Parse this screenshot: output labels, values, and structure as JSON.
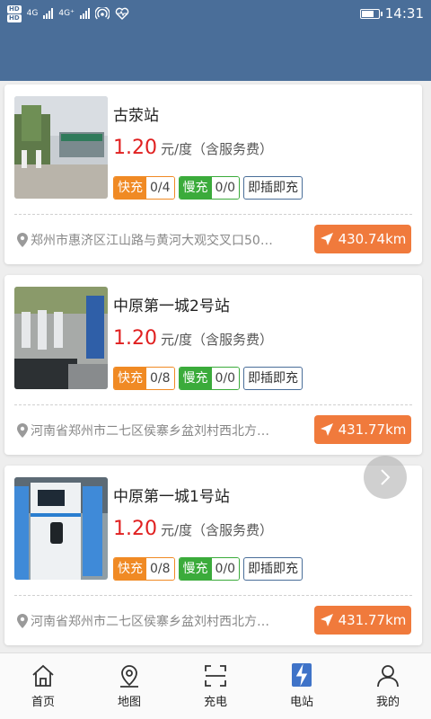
{
  "status_bar": {
    "hd1": "HD",
    "hd2": "HD",
    "net1": "4G",
    "net2": "4G⁺",
    "time": "14:31",
    "battery_level": 0.75
  },
  "stations": [
    {
      "name": "古荥站",
      "price": "1.20",
      "price_unit": "元/度（含服务费）",
      "fast_label": "快充",
      "fast_value": "0/4",
      "slow_label": "慢充",
      "slow_value": "0/0",
      "plug_label": "即插即充",
      "address": "郑州市惠济区江山路与黄河大观交叉口50…",
      "distance": "430.74km"
    },
    {
      "name": "中原第一城2号站",
      "price": "1.20",
      "price_unit": "元/度（含服务费）",
      "fast_label": "快充",
      "fast_value": "0/8",
      "slow_label": "慢充",
      "slow_value": "0/0",
      "plug_label": "即插即充",
      "address": "河南省郑州市二七区侯寨乡盆刘村西北方…",
      "distance": "431.77km"
    },
    {
      "name": "中原第一城1号站",
      "price": "1.20",
      "price_unit": "元/度（含服务费）",
      "fast_label": "快充",
      "fast_value": "0/8",
      "slow_label": "慢充",
      "slow_value": "0/0",
      "plug_label": "即插即充",
      "address": "河南省郑州市二七区侯寨乡盆刘村西北方…",
      "distance": "431.77km"
    }
  ],
  "tabbar": {
    "home": "首页",
    "map": "地图",
    "charge": "充电",
    "station": "电站",
    "mine": "我的",
    "active": "station"
  },
  "colors": {
    "header": "#4a6e99",
    "price": "#e02020",
    "fast": "#f08a24",
    "slow": "#3bab3b",
    "distance_button": "#f07a3c",
    "active_tab": "#3f73c8"
  }
}
